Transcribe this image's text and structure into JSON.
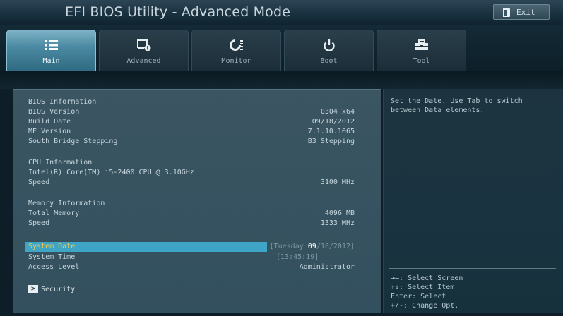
{
  "window": {
    "title": "EFI BIOS Utility - Advanced Mode",
    "exit_label": "Exit"
  },
  "tabs": [
    {
      "label": "Main",
      "icon": "list-icon",
      "active": true
    },
    {
      "label": "Advanced",
      "icon": "advanced-settings-icon",
      "active": false
    },
    {
      "label": "Monitor",
      "icon": "fan-monitor-icon",
      "active": false
    },
    {
      "label": "Boot",
      "icon": "power-icon",
      "active": false
    },
    {
      "label": "Tool",
      "icon": "toolbox-icon",
      "active": false
    }
  ],
  "main": {
    "bios_info": {
      "heading": "BIOS Information",
      "version_label": "BIOS Version",
      "version_value": "0304 x64",
      "build_date_label": "Build Date",
      "build_date_value": "09/18/2012",
      "me_version_label": "ME Version",
      "me_version_value": "7.1.10.1065",
      "south_bridge_label": "South Bridge Stepping",
      "south_bridge_value": "B3 Stepping"
    },
    "cpu_info": {
      "heading": "CPU Information",
      "model": "Intel(R) Core(TM) i5-2400 CPU @ 3.10GHz",
      "speed_label": "Speed",
      "speed_value": "3100 MHz"
    },
    "memory_info": {
      "heading": "Memory Information",
      "total_label": "Total Memory",
      "total_value": "4096 MB",
      "speed_label": "Speed",
      "speed_value": "1333 MHz"
    },
    "system_date": {
      "label": "System Date",
      "value_prefix": "[Tuesday ",
      "value_highlight": "09",
      "value_suffix": "/18/2012]"
    },
    "system_time": {
      "label": "System Time",
      "value": "[13:45:19]"
    },
    "access_level": {
      "label": "Access Level",
      "value": "Administrator"
    },
    "security": {
      "arrow": ">",
      "label": "Security"
    }
  },
  "help": {
    "description": "Set the Date. Use Tab to switch between Data elements.",
    "keys": [
      "→←: Select Screen",
      "↑↓: Select Item",
      "Enter: Select",
      "+/-: Change Opt."
    ]
  },
  "colors": {
    "accent": "#3ea5c7",
    "selected_text": "#f2c84b",
    "panel": "#3b5562"
  }
}
